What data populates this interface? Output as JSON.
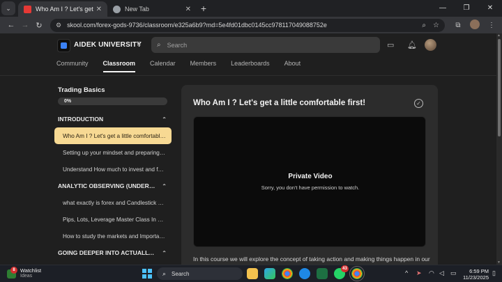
{
  "browser": {
    "tabs": [
      {
        "title": "Who Am I ? Let's get a little comfortable first!",
        "active": true,
        "favicon_color": "#e53935"
      },
      {
        "title": "New Tab",
        "active": false,
        "favicon_color": "#9aa0a6"
      }
    ],
    "new_tab_glyph": "+",
    "close_glyph": "✕",
    "window_controls": [
      "—",
      "❐",
      "✕"
    ],
    "url": "skool.com/forex-gods-9736/classroom/e325a6b9?md=5e4fd01dbc0145cc978117049088752e",
    "nav": {
      "back": "←",
      "forward": "→",
      "reload": "↻"
    }
  },
  "header": {
    "brand": "AIDEK UNIVERSITY",
    "switch_glyph": "⇅",
    "search_placeholder": "Search",
    "nav_tabs": [
      {
        "label": "Community",
        "active": false
      },
      {
        "label": "Classroom",
        "active": true
      },
      {
        "label": "Calendar",
        "active": false
      },
      {
        "label": "Members",
        "active": false
      },
      {
        "label": "Leaderboards",
        "active": false
      },
      {
        "label": "About",
        "active": false
      }
    ]
  },
  "sidebar": {
    "course_title": "Trading Basics",
    "progress_pct": 0,
    "progress_label": "0%",
    "sections": [
      {
        "title": "INTRODUCTION",
        "chevron": "⌃",
        "lessons": [
          {
            "label": "Who Am I ? Let's get a little comfortable first!",
            "active": true
          },
          {
            "label": "Setting up your mindset and preparing for the journey",
            "active": false
          },
          {
            "label": "Understand How much to invest and fund management",
            "active": false
          }
        ]
      },
      {
        "title": "ANALYTIC OBSERVING (UNDERSTANDING THE MARKETS)",
        "chevron": "⌃",
        "lessons": [
          {
            "label": "what exactly is forex and Candlestick analysis",
            "active": false
          },
          {
            "label": "Pips, Lots, Leverage Master Class In depth",
            "active": false
          },
          {
            "label": "How to study the markets and Important sessions",
            "active": false
          }
        ]
      },
      {
        "title": "GOING DEEPER INTO ACTUALLY MAKING MONEY",
        "chevron": "⌃",
        "lessons": []
      }
    ]
  },
  "lesson": {
    "title": "Who Am I ? Let's get a little comfortable first!",
    "check_glyph": "✓",
    "video_title": "Private Video",
    "video_subtitle": "Sorry, you don't have permission to watch.",
    "description": "In this course we will explore the concept of taking action and making things happen in our"
  },
  "taskbar": {
    "widget_title": "Watchlist",
    "widget_subtitle": "Ideas",
    "widget_badge": "8",
    "search_label": "Search",
    "whatsapp_badge": "43",
    "time": "6:59 PM",
    "date": "11/23/2025"
  },
  "colors": {
    "active_lesson_bg": "#f7d993",
    "card_bg": "#2c2c2c",
    "page_bg": "#1f1f1f",
    "accent_logo": "#3b82f6"
  }
}
